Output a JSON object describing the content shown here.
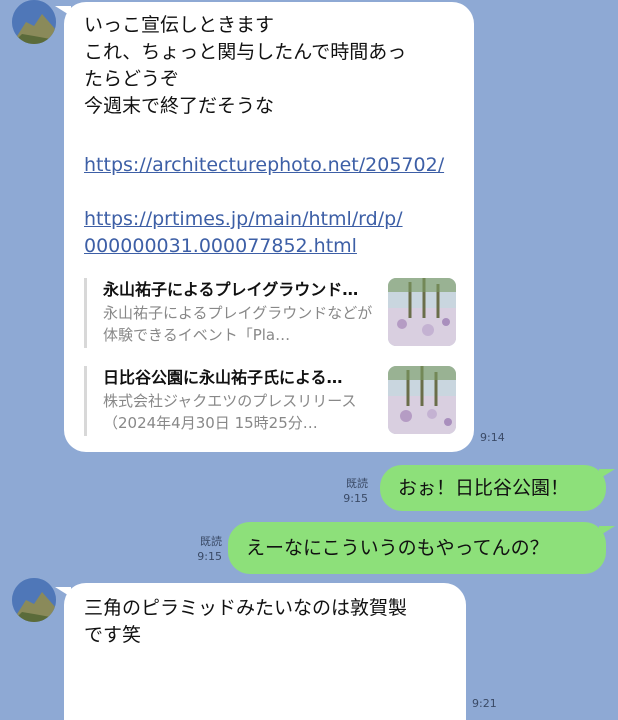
{
  "messages": {
    "m1": {
      "lines": [
        "いっこ宣伝しときます",
        "これ、ちょっと関与したんで時間あっ",
        "たらどうぞ",
        "今週末で終了だそうな"
      ],
      "link1": "https://architecturephoto.net/205702/",
      "link2_line1": "https://prtimes.jp/main/html/rd/p/",
      "link2_line2": "000000031.000077852.html",
      "preview1": {
        "title": "永山祐子によるプレイグラウンド…",
        "desc": "永山祐子によるプレイグラウンドなどが体験できるイベント「Pla…"
      },
      "preview2": {
        "title": "日比谷公園に永山祐子氏による…",
        "desc": "株式会社ジャクエツのプレスリリース（2024年4月30日 15時25分…"
      },
      "time": "9:14"
    },
    "m2": {
      "text": "おぉ！日比谷公園！",
      "read": "既読",
      "time": "9:15"
    },
    "m3": {
      "text": "えーなにこういうのもやってんの？",
      "read": "既読",
      "time": "9:15"
    },
    "m4": {
      "line1": "三角のピラミッドみたいなのは敦賀製",
      "line2": "です笑",
      "time": "9:21"
    }
  },
  "icons": {
    "avatar": "avatar-icon",
    "thumbnail": "image-thumbnail"
  },
  "colors": {
    "background": "#8ea9d4",
    "incoming_bubble": "#ffffff",
    "outgoing_bubble": "#8de07a",
    "link": "#3d5fa6"
  }
}
